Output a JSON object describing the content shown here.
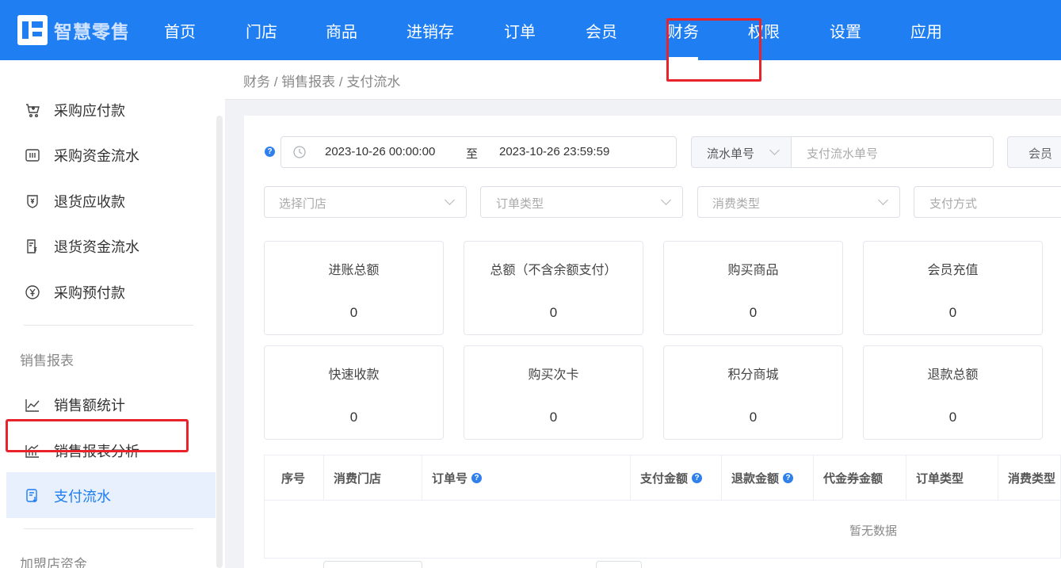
{
  "app": {
    "logo_text": "智慧零售"
  },
  "nav": {
    "items": [
      "首页",
      "门店",
      "商品",
      "进销存",
      "订单",
      "会员",
      "财务",
      "权限",
      "设置",
      "应用"
    ],
    "active": "财务"
  },
  "sidebar": {
    "items": [
      {
        "label": "采购应付款",
        "icon": "cart-icon"
      },
      {
        "label": "采购资金流水",
        "icon": "ledger-icon"
      },
      {
        "label": "退货应收款",
        "icon": "shield-yen-icon"
      },
      {
        "label": "退货资金流水",
        "icon": "receipt-yen-icon"
      },
      {
        "label": "采购预付款",
        "icon": "yen-circle-icon"
      }
    ],
    "group_sales": "销售报表",
    "sales_items": [
      {
        "label": "销售额统计",
        "icon": "line-chart-icon"
      },
      {
        "label": "销售报表分析",
        "icon": "bar-line-chart-icon"
      },
      {
        "label": "支付流水",
        "icon": "payment-flow-icon"
      }
    ],
    "active": "支付流水",
    "group_franchise": "加盟店资金"
  },
  "breadcrumb": "财务 / 销售报表 / 支付流水",
  "filters": {
    "date_start": "2023-10-26 00:00:00",
    "date_sep": "至",
    "date_end": "2023-10-26 23:59:59",
    "flow_type_select": "流水单号",
    "flow_no_placeholder": "支付流水单号",
    "member_label": "会员",
    "store_placeholder": "选择门店",
    "order_type_placeholder": "订单类型",
    "consume_type_placeholder": "消费类型",
    "pay_method_placeholder": "支付方式"
  },
  "stats": [
    {
      "label": "进账总额",
      "value": "0"
    },
    {
      "label": "总额（不含余额支付）",
      "value": "0"
    },
    {
      "label": "购买商品",
      "value": "0"
    },
    {
      "label": "会员充值",
      "value": "0"
    },
    {
      "label": "快速收款",
      "value": "0"
    },
    {
      "label": "购买次卡",
      "value": "0"
    },
    {
      "label": "积分商城",
      "value": "0"
    },
    {
      "label": "退款总额",
      "value": "0"
    }
  ],
  "table": {
    "columns": [
      "序号",
      "消费门店",
      "订单号",
      "支付金额",
      "退款金额",
      "代金券金额",
      "订单类型",
      "消费类型"
    ],
    "empty_text": "暂无数据"
  },
  "colors": {
    "primary": "#1e7ef2",
    "highlight_red": "#e8232b",
    "active_bg": "#e8f0fd"
  }
}
